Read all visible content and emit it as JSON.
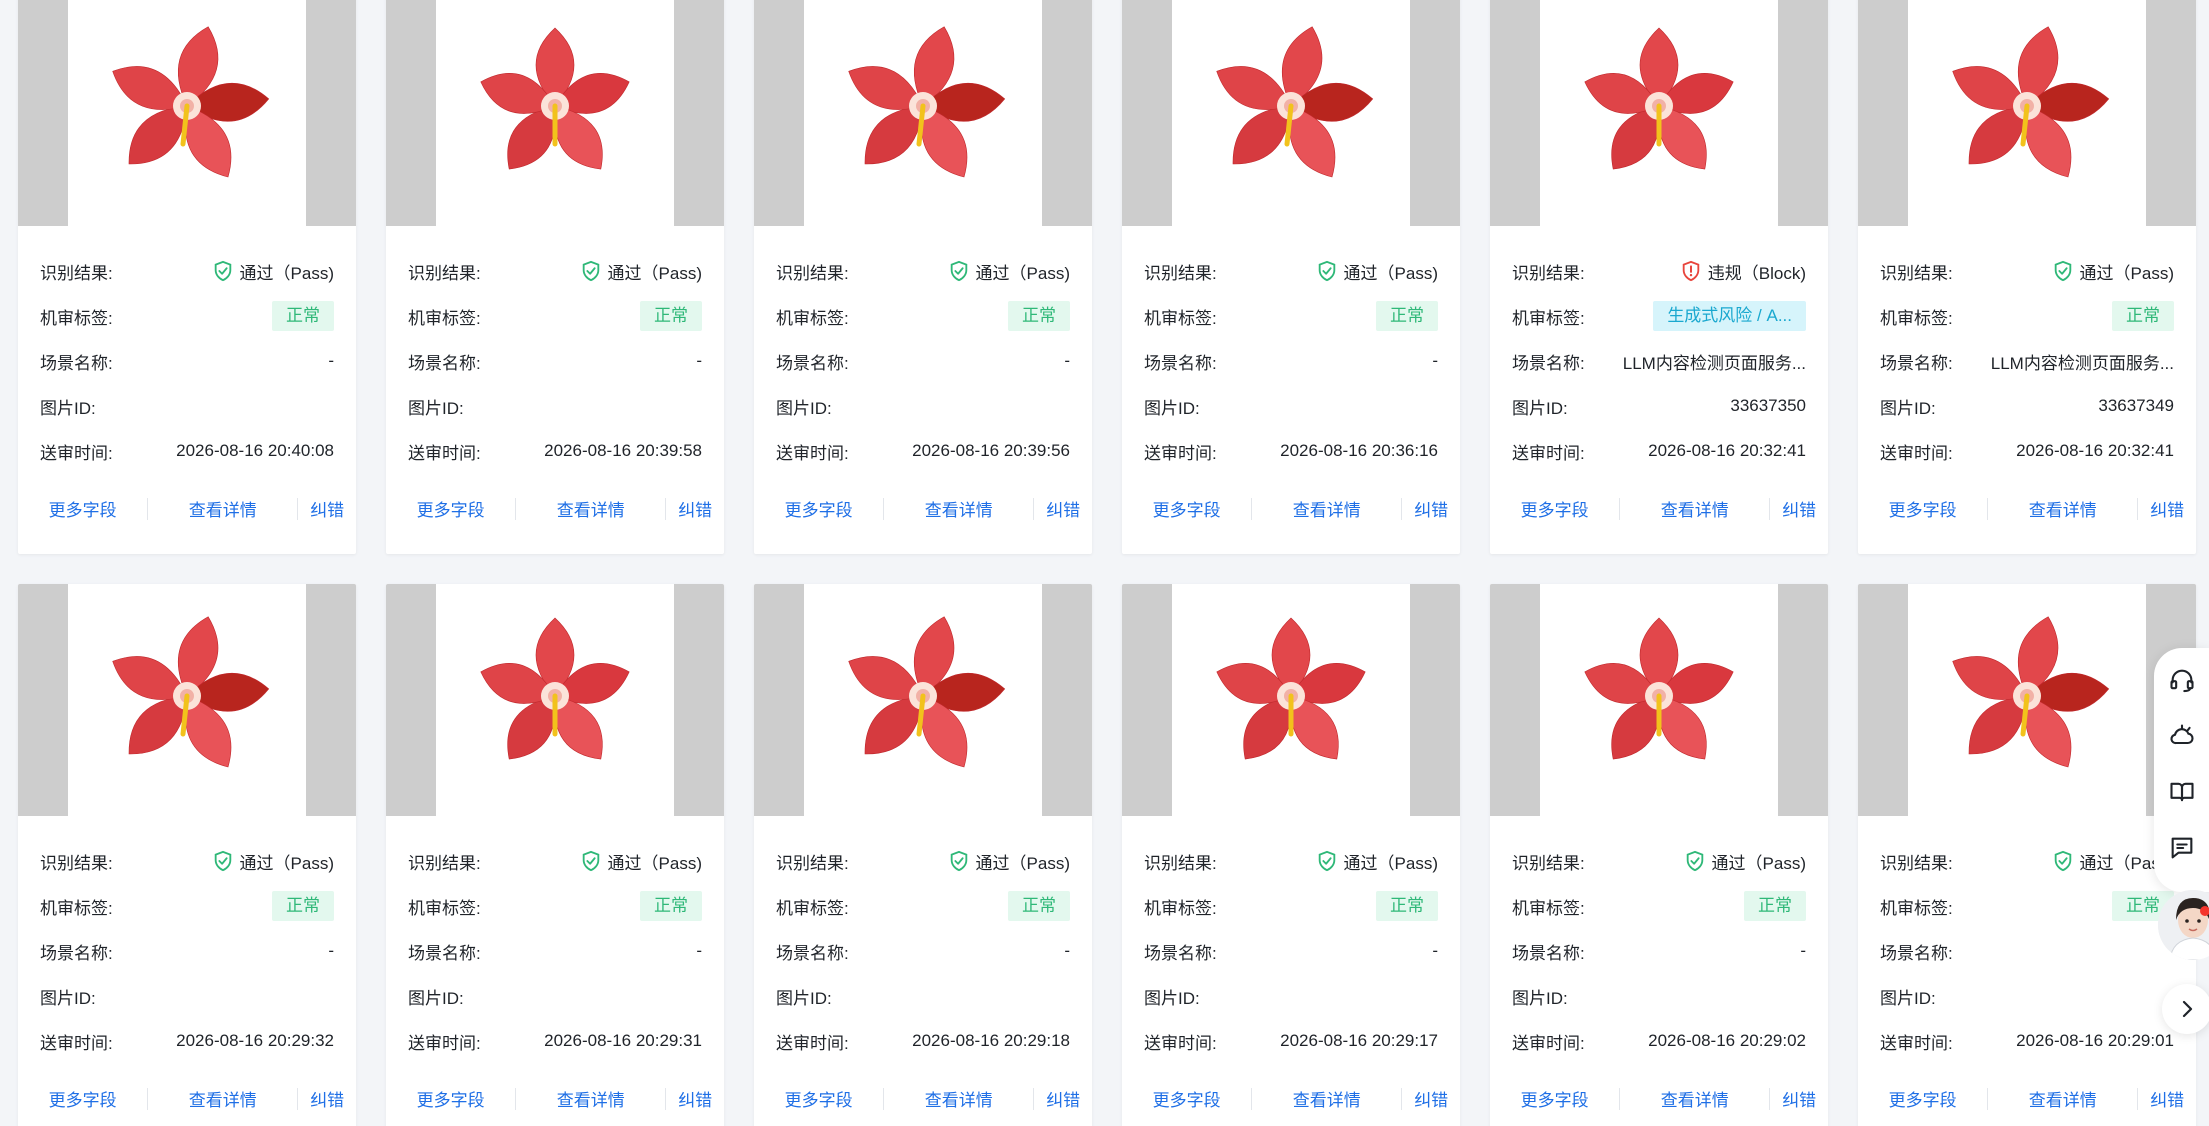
{
  "labels": {
    "result": "识别结果:",
    "tag": "机审标签:",
    "scene": "场景名称:",
    "image_id": "图片ID:",
    "time": "送审时间:"
  },
  "actions": {
    "more_fields": "更多字段",
    "view_details": "查看详情",
    "correct": "纠错"
  },
  "colors": {
    "pass_green": "#2fb878",
    "block_red": "#e8453c",
    "link_blue": "#1f6fe6",
    "risk_tag_bg": "#d6f4fb",
    "normal_tag_bg": "#e3f8ee"
  },
  "cards": [
    {
      "result": "通过（Pass)",
      "result_type": "pass",
      "tag": "正常",
      "tag_type": "normal",
      "scene": "-",
      "image_id": "",
      "time": "2026-08-16 20:40:08",
      "flower": "angled"
    },
    {
      "result": "通过（Pass)",
      "result_type": "pass",
      "tag": "正常",
      "tag_type": "normal",
      "scene": "-",
      "image_id": "",
      "time": "2026-08-16 20:39:58",
      "flower": "front"
    },
    {
      "result": "通过（Pass)",
      "result_type": "pass",
      "tag": "正常",
      "tag_type": "normal",
      "scene": "-",
      "image_id": "",
      "time": "2026-08-16 20:39:56",
      "flower": "angled"
    },
    {
      "result": "通过（Pass)",
      "result_type": "pass",
      "tag": "正常",
      "tag_type": "normal",
      "scene": "-",
      "image_id": "",
      "time": "2026-08-16 20:36:16",
      "flower": "angled"
    },
    {
      "result": "违规（Block)",
      "result_type": "block",
      "tag": "生成式风险 / A...",
      "tag_type": "risk",
      "scene": "LLM内容检测页面服务...",
      "image_id": "33637350",
      "time": "2026-08-16 20:32:41",
      "flower": "front"
    },
    {
      "result": "通过（Pass)",
      "result_type": "pass",
      "tag": "正常",
      "tag_type": "normal",
      "scene": "LLM内容检测页面服务...",
      "image_id": "33637349",
      "time": "2026-08-16 20:32:41",
      "flower": "angled"
    },
    {
      "result": "通过（Pass)",
      "result_type": "pass",
      "tag": "正常",
      "tag_type": "normal",
      "scene": "-",
      "image_id": "",
      "time": "2026-08-16 20:29:32",
      "flower": "angled"
    },
    {
      "result": "通过（Pass)",
      "result_type": "pass",
      "tag": "正常",
      "tag_type": "normal",
      "scene": "-",
      "image_id": "",
      "time": "2026-08-16 20:29:31",
      "flower": "front"
    },
    {
      "result": "通过（Pass)",
      "result_type": "pass",
      "tag": "正常",
      "tag_type": "normal",
      "scene": "-",
      "image_id": "",
      "time": "2026-08-16 20:29:18",
      "flower": "angled"
    },
    {
      "result": "通过（Pass)",
      "result_type": "pass",
      "tag": "正常",
      "tag_type": "normal",
      "scene": "-",
      "image_id": "",
      "time": "2026-08-16 20:29:17",
      "flower": "front"
    },
    {
      "result": "通过（Pass)",
      "result_type": "pass",
      "tag": "正常",
      "tag_type": "normal",
      "scene": "-",
      "image_id": "",
      "time": "2026-08-16 20:29:02",
      "flower": "front"
    },
    {
      "result": "通过（Pass)",
      "result_type": "pass",
      "tag": "正常",
      "tag_type": "normal",
      "scene": "",
      "image_id": "",
      "time": "2026-08-16 20:29:01",
      "flower": "angled"
    }
  ],
  "float_toolbar": {
    "icons": [
      "headset-icon",
      "cloud-icon",
      "book-icon",
      "feedback-icon"
    ],
    "avatar": "assistant-avatar",
    "expand": "chevron-right-icon"
  }
}
